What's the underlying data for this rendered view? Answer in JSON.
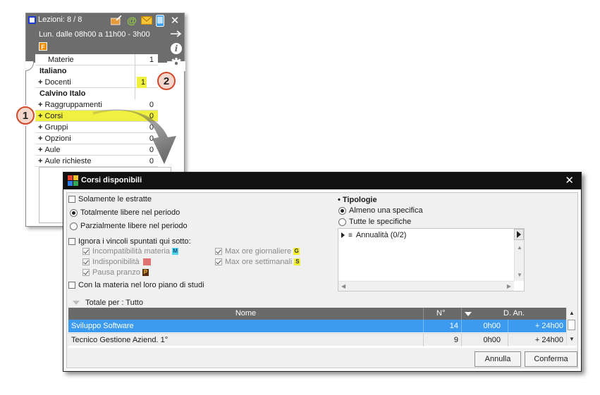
{
  "session": {
    "title": "Lezioni: 8 / 8",
    "time_range": "Lun. dalle 08h00 a 11h00 - 3h00",
    "badge": "F",
    "info_glyph": "i",
    "close_glyph": "✕",
    "rows": [
      {
        "label": "Materie",
        "value": "1"
      },
      {
        "label": "Italiano",
        "value": ""
      },
      {
        "label": "Docenti",
        "value": "1"
      },
      {
        "label": "Calvino Italo",
        "value": ""
      },
      {
        "label": "Raggruppamenti",
        "value": "0"
      },
      {
        "label": "Corsi",
        "value": "0"
      },
      {
        "label": "Gruppi",
        "value": "0"
      },
      {
        "label": "Opzioni",
        "value": "0"
      },
      {
        "label": "Aule",
        "value": "0"
      },
      {
        "label": "Aule richieste",
        "value": "0"
      }
    ],
    "plus_glyph": "+"
  },
  "callouts": {
    "one": "1",
    "two": "2"
  },
  "dialog": {
    "title": "Corsi disponibili",
    "close_glyph": "✕",
    "options": {
      "solamente_estratte": "Solamente le estratte",
      "totalmente_libere": "Totalmente libere nel periodo",
      "parzialmente_libere": "Parzialmente libere nel periodo",
      "ignora_vincoli": "Ignora i vincoli spuntati qui sotto:",
      "incompatibilita": "Incompatibilità materia",
      "incompatibilita_tag": "M",
      "indisponibilita": "Indisponibilità",
      "pausa_pranzo": "Pausa pranzo",
      "pausa_tag": "P",
      "max_giornaliere": "Max ore giornaliere",
      "max_giornaliere_tag": "G",
      "max_settimanali": "Max ore settimanali",
      "max_settimanali_tag": "S",
      "con_materia": "Con la materia nel loro piano di studi"
    },
    "tipologie": {
      "title": "• Tipologie",
      "almeno": "Almeno una specifica",
      "tutte": "Tutte le specifiche",
      "list_glyph": "≡",
      "item": "Annualità (0/2)"
    },
    "totale_per": "Totale per :  Tutto",
    "table": {
      "headers": {
        "nome": "Nome",
        "n": "N°",
        "dan": "D. An."
      },
      "rows": [
        {
          "nome": "Sviluppo Software",
          "n": "14",
          "h": "0h00",
          "dur": "+ 24h00"
        },
        {
          "nome": "Tecnico Gestione Aziend.  1°",
          "n": "9",
          "h": "0h00",
          "dur": "+ 24h00"
        }
      ]
    },
    "buttons": {
      "annulla": "Annulla",
      "conferma": "Conferma"
    }
  },
  "colors": {
    "panel_header": "#6d6d6d",
    "highlight": "#f0f040",
    "selected_row": "#3c9bef",
    "callout_border": "#d04a2a"
  }
}
